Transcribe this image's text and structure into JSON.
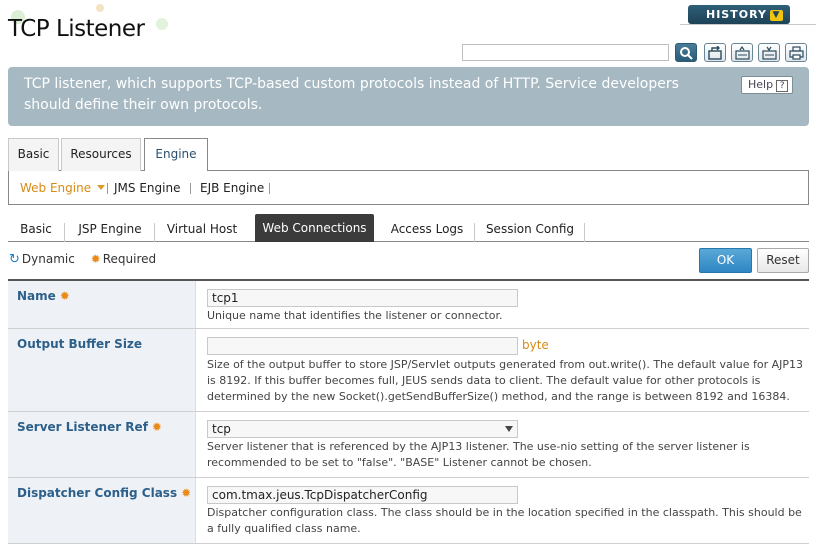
{
  "page": {
    "title": "TCP Listener",
    "history_label": "HISTORY",
    "description": "TCP listener, which supports TCP-based custom protocols instead of HTTP. Service developers should define their own protocols.",
    "help_label": "Help",
    "search_placeholder": ""
  },
  "toolbar": {
    "icons": [
      "search-icon",
      "export-icon",
      "xml-export-icon",
      "xml-import-icon",
      "print-icon"
    ]
  },
  "tabs_main": [
    "Basic",
    "Resources",
    "Engine"
  ],
  "engine_nav": [
    "Web Engine",
    "JMS Engine",
    "EJB Engine"
  ],
  "tabs_web": [
    "Basic",
    "JSP Engine",
    "Virtual Host",
    "Web Connections",
    "Access Logs",
    "Session Config"
  ],
  "legend": {
    "dynamic": "Dynamic",
    "required": "Required"
  },
  "actions": {
    "ok": "OK",
    "reset": "Reset"
  },
  "fields": {
    "name": {
      "label": "Name",
      "value": "tcp1",
      "desc": "Unique name that identifies the listener or connector."
    },
    "output_buffer_size": {
      "label": "Output Buffer Size",
      "value": "",
      "unit": "byte",
      "desc": "Size of the output buffer to store JSP/Servlet outputs generated from out.write(). The default value for AJP13 is 8192. If this buffer becomes full, JEUS sends data to client. The default value for other protocols is determined by the new Socket().getSendBufferSize() method, and the range is between 8192 and 16384."
    },
    "server_listener_ref": {
      "label": "Server Listener Ref",
      "value": "tcp",
      "desc": "Server listener that is referenced by the AJP13 listener. The use-nio setting of the server listener is recommended to be set to \"false\". \"BASE\" Listener cannot be chosen."
    },
    "dispatcher_config_class": {
      "label": "Dispatcher Config Class",
      "value": "com.tmax.jeus.TcpDispatcherConfig",
      "desc": "Dispatcher configuration class. The class should be in the location specified in the classpath. This should be a fully qualified class name."
    }
  },
  "colors": {
    "accent_blue": "#2c5f8a",
    "required_orange": "#e88a1a",
    "description_bar": "#a6b8c1"
  }
}
